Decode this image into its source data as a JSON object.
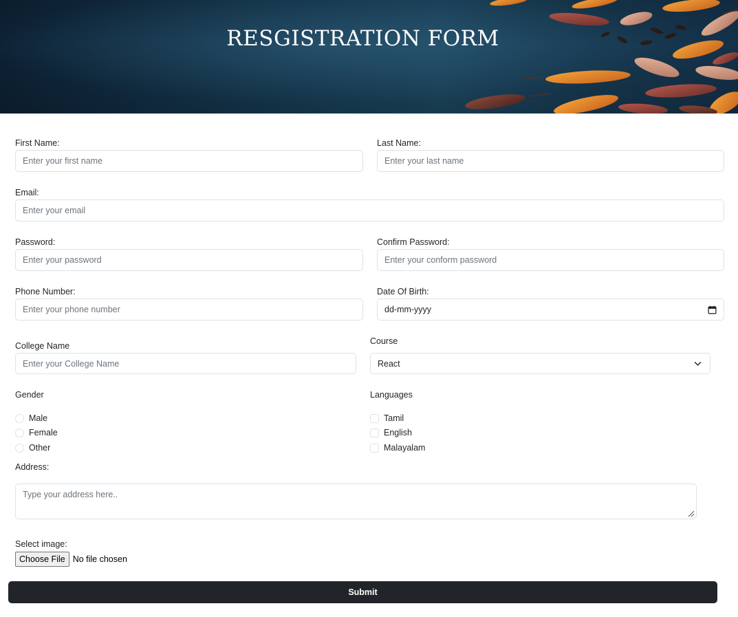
{
  "header": {
    "title": "RESGISTRATION FORM"
  },
  "form": {
    "first_name": {
      "label": "First Name:",
      "placeholder": "Enter your first name"
    },
    "last_name": {
      "label": "Last Name:",
      "placeholder": "Enter your last name"
    },
    "email": {
      "label": "Email:",
      "placeholder": "Enter your email"
    },
    "password": {
      "label": "Password:",
      "placeholder": "Enter your password"
    },
    "confirm_password": {
      "label": "Confirm Password:",
      "placeholder": "Enter your conform password"
    },
    "phone": {
      "label": "Phone Number:",
      "placeholder": "Enter your phone number"
    },
    "dob": {
      "label": "Date Of Birth:",
      "value": "dd-mm-yyyy",
      "icon": "calendar-icon"
    },
    "college": {
      "label": "College Name",
      "placeholder": "Enter your College Name"
    },
    "course": {
      "label": "Course",
      "selected": "React",
      "icon": "chevron-down-icon"
    },
    "gender": {
      "label": "Gender",
      "options": [
        "Male",
        "Female",
        "Other"
      ]
    },
    "languages": {
      "label": "Languages",
      "options": [
        "Tamil",
        "English",
        "Malayalam"
      ]
    },
    "address": {
      "label": "Address:",
      "placeholder": "Type your address here.."
    },
    "image": {
      "label": "Select image:",
      "button_label": "Choose File",
      "status": "No file chosen"
    },
    "submit_label": "Submit"
  },
  "colors": {
    "banner_dark": "#0d2235",
    "banner_mid": "#1d4862",
    "input_border": "#dee2e6",
    "placeholder": "#6c757d",
    "submit_bg": "#212529",
    "text": "#212529"
  }
}
